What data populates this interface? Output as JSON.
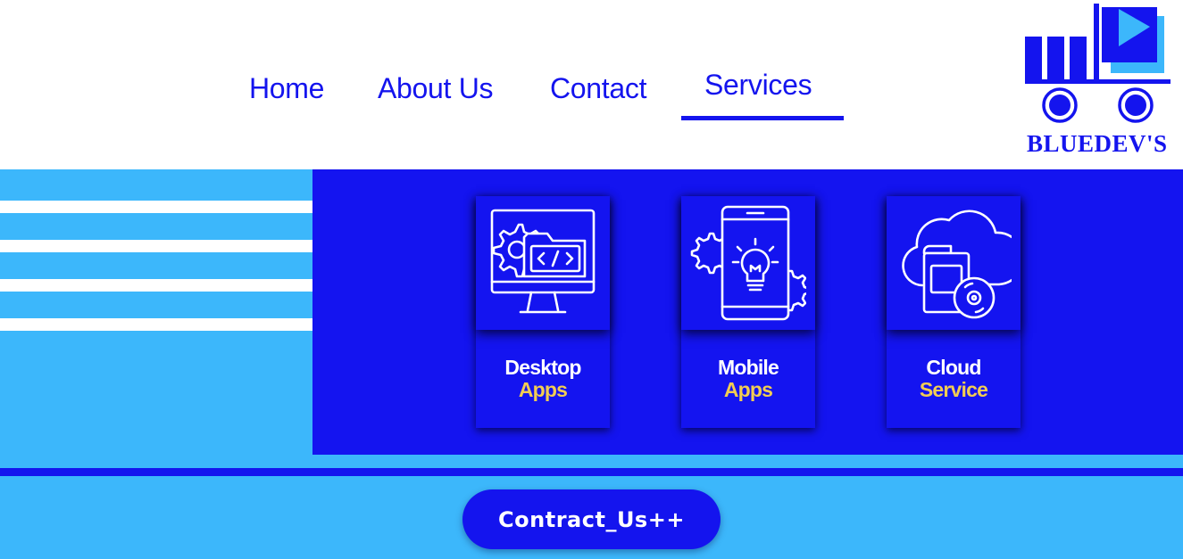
{
  "nav": {
    "items": [
      {
        "label": "Home"
      },
      {
        "label": "About Us"
      },
      {
        "label": "Contact"
      },
      {
        "label": "Services",
        "active": true
      }
    ]
  },
  "logo": {
    "text": "BLUEDEV'S",
    "icon": "truck-play-logo"
  },
  "services": [
    {
      "title_line1": "Desktop",
      "title_line2": "Apps",
      "icon": "desktop-code-icon"
    },
    {
      "title_line1": "Mobile",
      "title_line2": "Apps",
      "icon": "mobile-bulb-icon"
    },
    {
      "title_line1": "Cloud",
      "title_line2": "Service",
      "icon": "cloud-disc-icon"
    }
  ],
  "cta": {
    "label": "Contract_Us++"
  },
  "colors": {
    "primary": "#1414ee",
    "light_blue": "#3cb7fb",
    "accent_yellow": "#f2cd52",
    "white": "#ffffff"
  }
}
